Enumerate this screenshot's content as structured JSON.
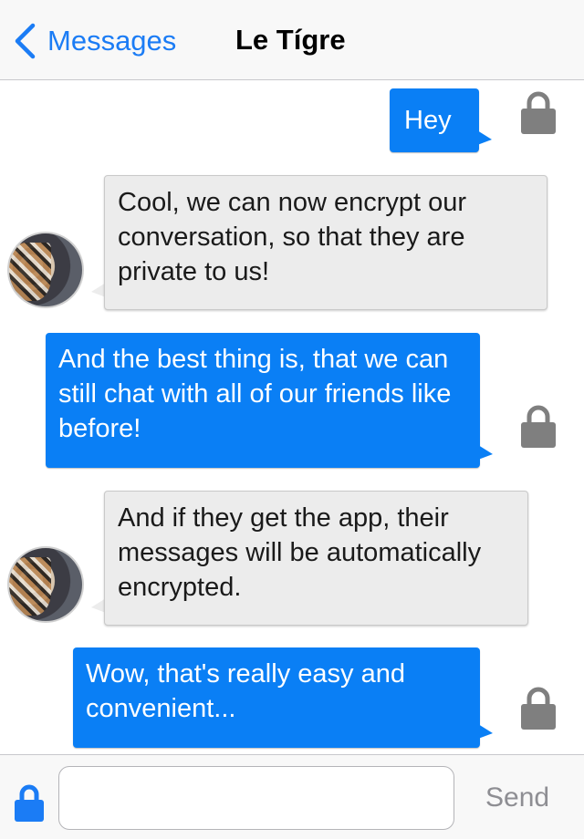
{
  "navbar": {
    "back_label": "Messages",
    "title": "Le Tígre"
  },
  "messages": [
    {
      "direction": "outgoing",
      "text": "Hey",
      "encrypted": true
    },
    {
      "direction": "incoming",
      "text": "Cool, we can now encrypt our conversation, so that they are private to us!",
      "encrypted": true
    },
    {
      "direction": "outgoing",
      "text": "And the best thing is, that we can still chat with all of our friends like before!",
      "encrypted": true
    },
    {
      "direction": "incoming",
      "text": "And if they get the app, their messages will be automatically encrypted.",
      "encrypted": true
    },
    {
      "direction": "outgoing",
      "text": "Wow, that's really easy and convenient...",
      "encrypted": true
    }
  ],
  "composer": {
    "value": "",
    "placeholder": "",
    "send_label": "Send"
  },
  "colors": {
    "accent": "#0a7ff5",
    "incoming_bubble": "#ececec",
    "lock_outgoing": "#7f7f7f",
    "lock_composer": "#1b7cf5",
    "send_disabled": "#8e8e93"
  },
  "icons": [
    "chevron-left-icon",
    "lock-icon",
    "avatar"
  ]
}
